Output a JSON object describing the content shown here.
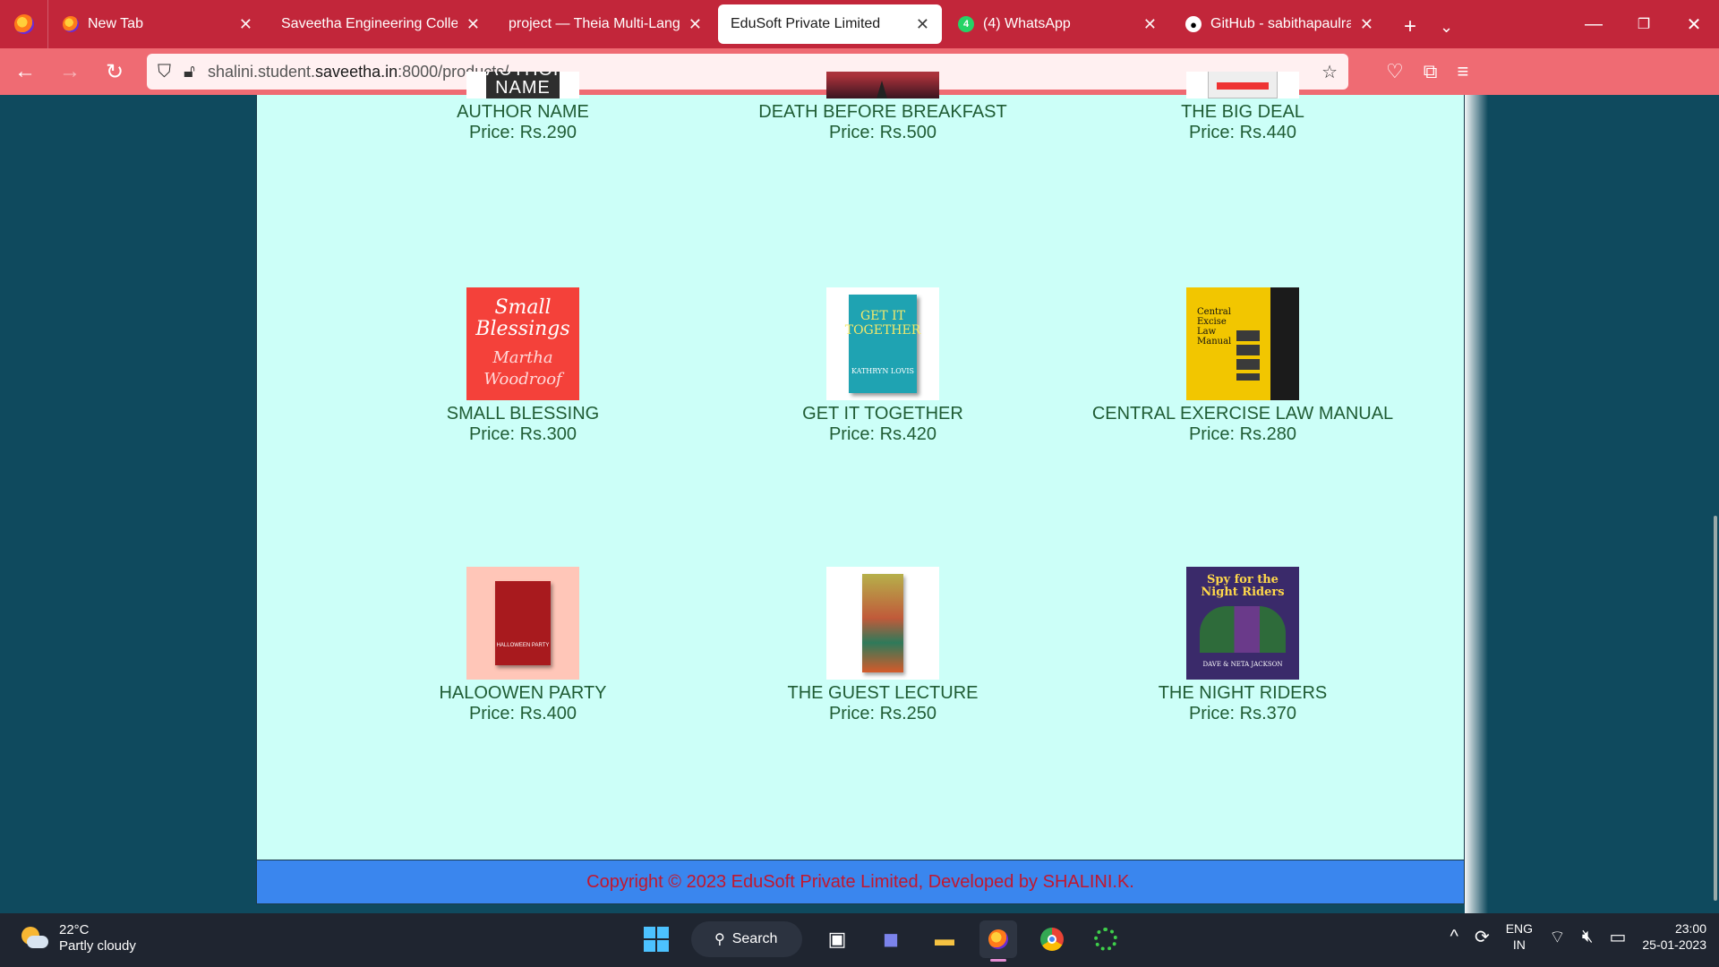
{
  "browser": {
    "tabs": [
      {
        "title": "New Tab",
        "favicon": "firefox-icon",
        "active": false
      },
      {
        "title": "Saveetha Engineering College",
        "favicon": "none",
        "active": false
      },
      {
        "title": "project — Theia Multi-Language",
        "favicon": "none",
        "active": false
      },
      {
        "title": "EduSoft Private Limited",
        "favicon": "none",
        "active": true
      },
      {
        "title": "(4) WhatsApp",
        "favicon": "whatsapp-icon",
        "active": false
      },
      {
        "title": "GitHub - sabithapaulraj/pro",
        "favicon": "github-icon",
        "active": false
      }
    ],
    "url": {
      "prefix": "shalini.student.",
      "host": "saveetha.in",
      "suffix": ":8000/products/"
    }
  },
  "products": [
    {
      "name": "AUTHOR NAME",
      "price": "Price: Rs.290"
    },
    {
      "name": "DEATH BEFORE BREAKFAST",
      "price": "Price: Rs.500"
    },
    {
      "name": "THE BIG DEAL",
      "price": "Price: Rs.440"
    },
    {
      "name": "SMALL BLESSING",
      "price": "Price: Rs.300"
    },
    {
      "name": "GET IT TOGETHER",
      "price": "Price: Rs.420"
    },
    {
      "name": "CENTRAL EXERCISE LAW MANUAL",
      "price": "Price: Rs.280"
    },
    {
      "name": "HALOOWEN PARTY",
      "price": "Price: Rs.400"
    },
    {
      "name": "THE GUEST LECTURE",
      "price": "Price: Rs.250"
    },
    {
      "name": "THE NIGHT RIDERS",
      "price": "Price: Rs.370"
    }
  ],
  "covers": {
    "author_name": "AUTHOR NAME",
    "small_blessings": {
      "line1": "Small",
      "line2": "Blessings",
      "author": "Martha Woodroof"
    },
    "get_together": {
      "title": "GET IT TOGETHER",
      "author": "KATHRYN LOVIS"
    },
    "excise": {
      "title": "Central Excise Law Manual"
    },
    "halloween": "HALLOWEEN PARTY",
    "spy": {
      "title": "Spy for the Night Riders",
      "author": "DAVE & NETA JACKSON"
    }
  },
  "footer": {
    "text": "Copyright © 2023 EduSoft Private Limited, Developed by SHALINI.K."
  },
  "taskbar": {
    "temperature": "22°C",
    "weather": "Partly cloudy",
    "search_label": "Search",
    "lang_line1": "ENG",
    "lang_line2": "IN",
    "time": "23:00",
    "date": "25-01-2023"
  },
  "colors": {
    "tab_strip": "#c2263a",
    "toolbar": "#ef6b73",
    "page_bg": "#ccfff8",
    "product_text": "#1f5c34",
    "footer_bg": "#3a86ee",
    "footer_text": "#c2172e",
    "backdrop": "#0f4a5e"
  }
}
